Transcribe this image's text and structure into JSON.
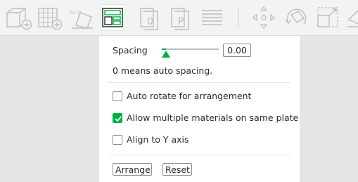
{
  "toolbar": {
    "items": [
      {
        "icon": "add-plate-icon"
      },
      {
        "icon": "add-grid-plate-icon"
      },
      {
        "icon": "auto-orient-icon",
        "label": "AUTO"
      },
      {
        "icon": "arrange-icon",
        "active": true
      },
      {
        "icon": "plate-object-icon",
        "label": "0"
      },
      {
        "icon": "plate-p-icon",
        "label": "P"
      },
      {
        "icon": "split-lines-icon"
      },
      {
        "icon": "move-icon"
      },
      {
        "icon": "rotate-icon"
      },
      {
        "icon": "scale-icon"
      },
      {
        "icon": "lay-on-face-icon"
      }
    ]
  },
  "panel": {
    "spacing_label": "Spacing",
    "spacing_value": "0.00",
    "spacing_slider_fraction": 0.0,
    "spacing_note": "0 means auto spacing.",
    "options": [
      {
        "label": "Auto rotate for arrangement",
        "checked": false
      },
      {
        "label": "Allow multiple materials on same plate",
        "checked": true
      },
      {
        "label": "Align to Y axis",
        "checked": false
      }
    ],
    "arrange_label": "Arrange",
    "reset_label": "Reset"
  },
  "colors": {
    "accent": "#00ae42",
    "panel_bg": "#ffffff",
    "toolbar_bg": "#f3f3f3"
  }
}
